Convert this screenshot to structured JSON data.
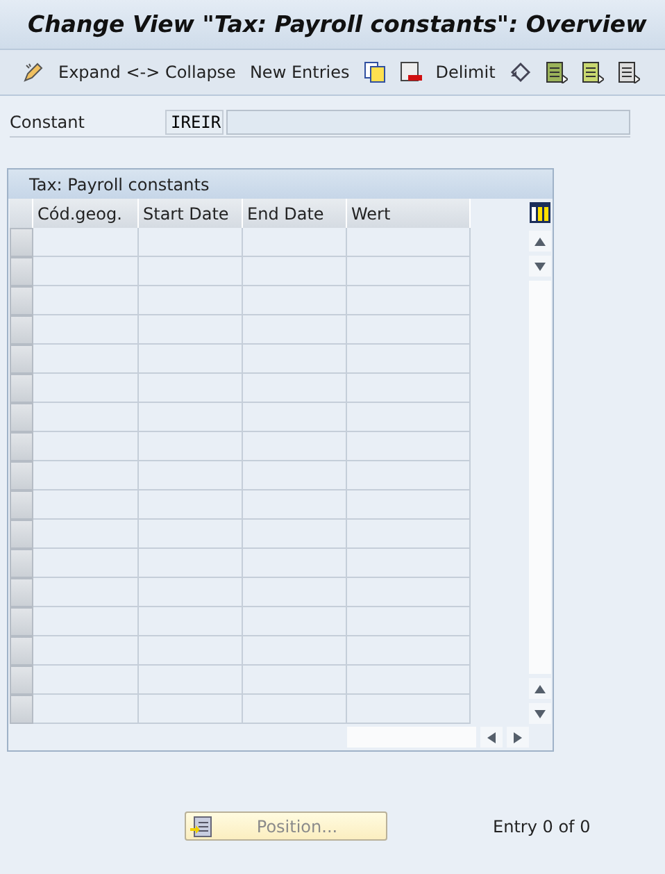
{
  "window": {
    "title": "Change View \"Tax: Payroll constants\": Overview"
  },
  "toolbar": [
    "Expand <-> Collapse",
    "New Entries",
    "Delimit"
  ],
  "constant": {
    "label": "Constant",
    "value": "IREIR"
  },
  "table": {
    "title": "Tax: Payroll constants",
    "columns": [
      "Cód.geog.",
      "Start Date",
      "End Date",
      "Wert"
    ]
  },
  "position_button": {
    "label": "Position...",
    "disabled": true
  },
  "entry_info": "Entry 0 of 0"
}
